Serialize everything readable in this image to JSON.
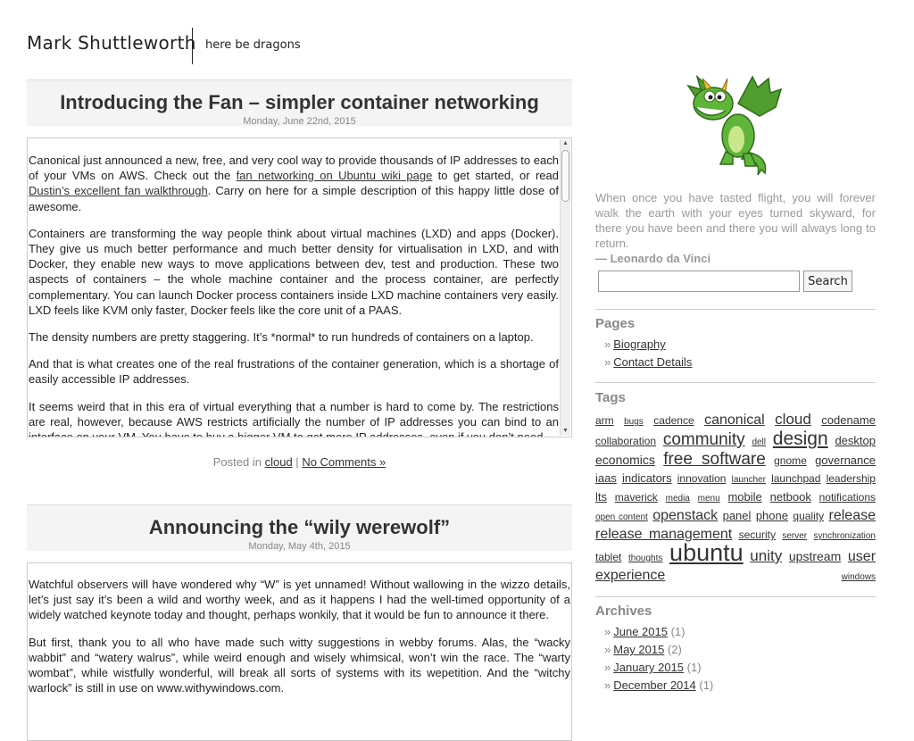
{
  "header": {
    "site_title": "Mark Shuttleworth",
    "tagline": "here be dragons"
  },
  "posts": [
    {
      "title": "Introducing the Fan – simpler container networking",
      "date": "Monday, June 22nd, 2015",
      "p1_pre": "Canonical just announced a new, free, and very cool way to provide thousands of IP addresses to each of your VMs on AWS. Check out the ",
      "p1_link1": "fan networking on Ubuntu wiki page",
      "p1_mid": " to get started, or read ",
      "p1_link2": "Dustin’s excellent fan walkthrough",
      "p1_post": ". Carry on here for a simple description of this happy little dose of awesome.",
      "p2": "Containers are transforming the way people think about virtual machines (LXD) and apps (Docker). They give us much better performance and much better density for virtualisation in LXD, and with Docker, they enable new ways to move applications between dev, test and production. These two aspects of containers – the whole machine container and the process container, are perfectly complementary. You can launch Docker process containers inside LXD machine containers very easily. LXD feels like KVM only faster, Docker feels like the core unit of a PAAS.",
      "p3": "The density numbers are pretty staggering. It’s *normal* to run hundreds of containers on a laptop.",
      "p4": "And that is what creates one of the real frustrations of the container generation, which is a shortage of easily accessible IP addresses.",
      "p5": "It seems weird that in this era of virtual everything that a number is hard to come by. The restrictions are real, however, because AWS restricts artificially the number of IP addresses you can bind to an interface on your VM. You have to buy a bigger VM to get more IP addresses, even if you don’t need",
      "footer_posted": "Posted in",
      "footer_category": "cloud",
      "footer_sep": "|",
      "footer_comments": "No Comments »"
    },
    {
      "title": "Announcing the “wily werewolf”",
      "date": "Monday, May 4th, 2015",
      "p1": "Watchful observers will have wondered why “W” is yet unnamed! Without wallowing in the wizzo details, let’s just say it’s been a wild and worthy week, and as it happens I had the well-timed opportunity of a widely watched keynote today and thought, perhaps wonkily, that it would be fun to announce it there.",
      "p2": "But first, thank you to all who have made such witty suggestions in webby forums. Alas, the “wacky wabbit” and “watery walrus”, while weird enough and wisely whimsical, won’t win the race. The “warty wombat”, while wistfully wonderful, will break all sorts of systems with its wepetition. And the “witchy warlock” is still in use on www.withywindows.com."
    }
  ],
  "sidebar": {
    "quote_text": "When once you have tasted flight, you will forever walk the earth with your eyes turned skyward, for there you have been and there you will always long to return.",
    "quote_author": "— Leonardo da Vinci",
    "search_placeholder": "",
    "search_button": "Search",
    "pages_heading": "Pages",
    "pages": [
      "Biography",
      "Contact Details"
    ],
    "tags_heading": "Tags",
    "tags": [
      {
        "label": "arm",
        "size": 12
      },
      {
        "label": "bugs",
        "size": 10
      },
      {
        "label": "cadence",
        "size": 12
      },
      {
        "label": "canonical",
        "size": 16
      },
      {
        "label": "cloud",
        "size": 17
      },
      {
        "label": "codename",
        "size": 13
      },
      {
        "label": "collaboration",
        "size": 12
      },
      {
        "label": "community",
        "size": 19
      },
      {
        "label": "dell",
        "size": 10
      },
      {
        "label": "design",
        "size": 21
      },
      {
        "label": "desktop",
        "size": 13
      },
      {
        "label": "economics",
        "size": 14
      },
      {
        "label": "free software",
        "size": 19
      },
      {
        "label": "gnome",
        "size": 12
      },
      {
        "label": "governance",
        "size": 13
      },
      {
        "label": "iaas",
        "size": 13
      },
      {
        "label": "indicators",
        "size": 13
      },
      {
        "label": "innovation",
        "size": 12
      },
      {
        "label": "launcher",
        "size": 10
      },
      {
        "label": "launchpad",
        "size": 12
      },
      {
        "label": "leadership",
        "size": 12
      },
      {
        "label": "lts",
        "size": 13
      },
      {
        "label": "maverick",
        "size": 12
      },
      {
        "label": "media",
        "size": 10
      },
      {
        "label": "menu",
        "size": 10
      },
      {
        "label": "mobile",
        "size": 13
      },
      {
        "label": "netbook",
        "size": 13
      },
      {
        "label": "notifications",
        "size": 12
      },
      {
        "label": "open content",
        "size": 10
      },
      {
        "label": "openstack",
        "size": 16
      },
      {
        "label": "panel",
        "size": 13
      },
      {
        "label": "phone",
        "size": 13
      },
      {
        "label": "quality",
        "size": 12
      },
      {
        "label": "release",
        "size": 16
      },
      {
        "label": "release management",
        "size": 16
      },
      {
        "label": "security",
        "size": 12
      },
      {
        "label": "server",
        "size": 10
      },
      {
        "label": "synchronization",
        "size": 10
      },
      {
        "label": "tablet",
        "size": 12
      },
      {
        "label": "thoughts",
        "size": 10
      },
      {
        "label": "ubuntu",
        "size": 27
      },
      {
        "label": "unity",
        "size": 17
      },
      {
        "label": "upstream",
        "size": 14
      },
      {
        "label": "user experience",
        "size": 16
      },
      {
        "label": "windows",
        "size": 10
      }
    ],
    "archives_heading": "Archives",
    "archives": [
      {
        "label": "June 2015",
        "count": "(1)"
      },
      {
        "label": "May 2015",
        "count": "(2)"
      },
      {
        "label": "January 2015",
        "count": "(1)"
      },
      {
        "label": "December 2014",
        "count": "(1)"
      }
    ],
    "list_marker": "»"
  },
  "colors": {
    "text": "#333333",
    "muted": "#888888",
    "quote": "#999999",
    "post_header_bg": "#f4f4f4",
    "dragon_green": "#5fb53a"
  }
}
